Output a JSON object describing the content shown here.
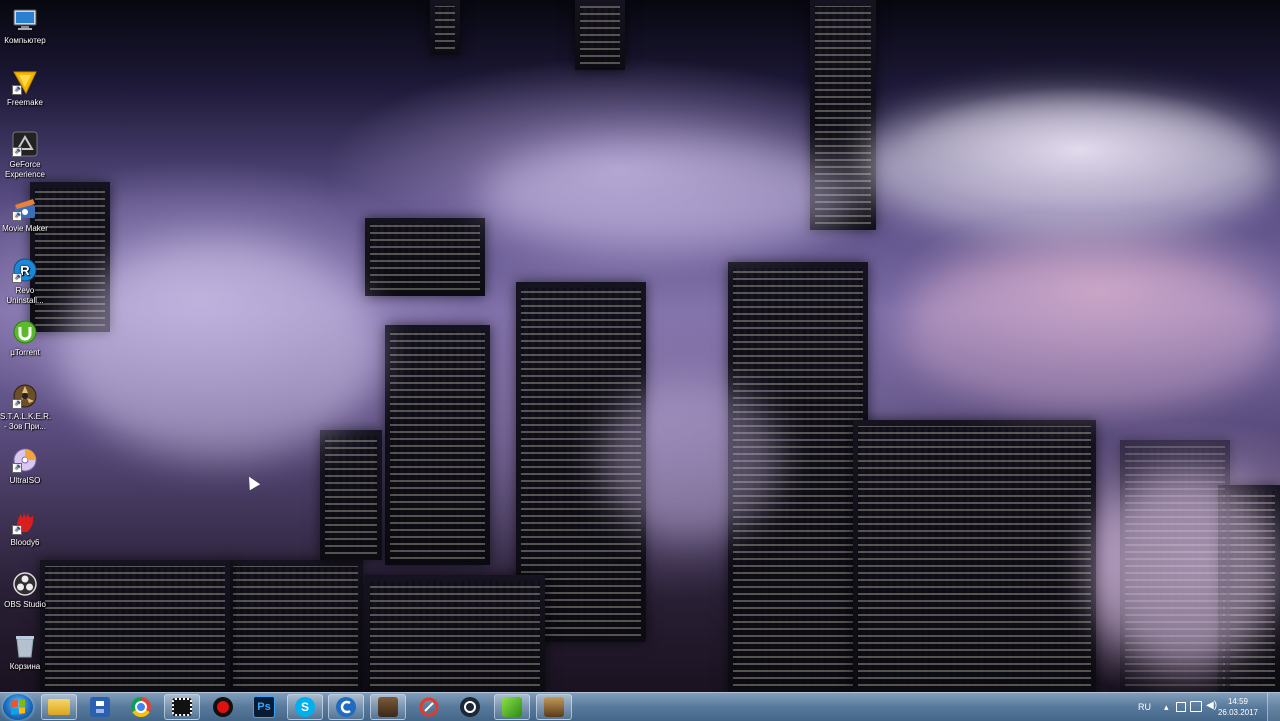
{
  "desktop_icons": [
    {
      "label": "Компьютер",
      "icon": "computer-icon"
    },
    {
      "label": "Freemake",
      "icon": "freemake-icon"
    },
    {
      "label": "GeForce Experience",
      "icon": "geforce-experience-icon"
    },
    {
      "label": "Movie Maker",
      "icon": "movie-maker-icon"
    },
    {
      "label": "Revo Uninstall...",
      "icon": "revo-uninstaller-icon"
    },
    {
      "label": "µTorrent",
      "icon": "utorrent-icon"
    },
    {
      "label": "S.T.A.L.K.E.R. - Зов При...",
      "icon": "stalker-icon"
    },
    {
      "label": "UltraISO",
      "icon": "ultraiso-icon"
    },
    {
      "label": "Bloody6",
      "icon": "bloody-icon"
    },
    {
      "label": "OBS Studio",
      "icon": "obs-studio-icon"
    },
    {
      "label": "Корзина",
      "icon": "recycle-bin-icon"
    }
  ],
  "taskbar": {
    "start_icon": "windows-start-icon",
    "pinned": [
      {
        "icon": "chrome-icon"
      },
      {
        "icon": "file-explorer-icon"
      },
      {
        "icon": "floppy-save-icon"
      },
      {
        "icon": "chrome-icon"
      },
      {
        "icon": "film-strip-icon"
      },
      {
        "icon": "record-icon"
      },
      {
        "icon": "photoshop-icon",
        "text": "Ps"
      },
      {
        "icon": "skype-icon"
      },
      {
        "icon": "ccleaner-icon"
      },
      {
        "icon": "game-stalker-icon"
      },
      {
        "icon": "ccleaner-broom-icon"
      },
      {
        "icon": "steam-icon"
      },
      {
        "icon": "green-app-icon"
      },
      {
        "icon": "game-cowboy-icon"
      }
    ],
    "tray": {
      "language": "RU",
      "time": "14:59",
      "date": "26.03.2017"
    }
  },
  "colors": {
    "taskbar": "#5f82a5",
    "accent": "#1d6fc0"
  }
}
